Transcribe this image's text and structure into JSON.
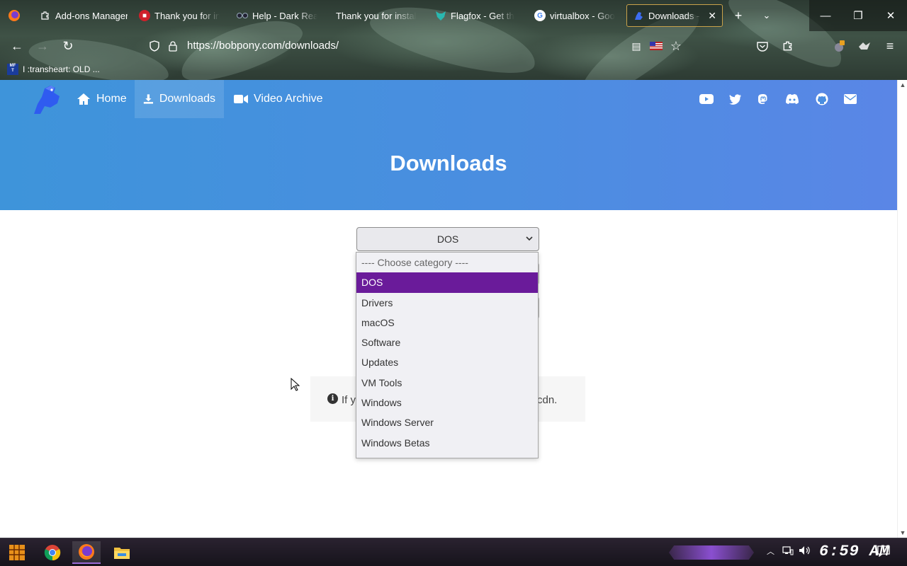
{
  "browser": {
    "tabs": [
      {
        "title": "Add-ons Manager",
        "icon": "puzzle-icon"
      },
      {
        "title": "Thank you for ins",
        "icon": "shield-icon"
      },
      {
        "title": "Help - Dark Read",
        "icon": "glasses-icon"
      },
      {
        "title": "Thank you for install",
        "icon": ""
      },
      {
        "title": "Flagfox - Get th",
        "icon": "flagfox-icon"
      },
      {
        "title": "virtualbox - Goo",
        "icon": "google-icon"
      },
      {
        "title": "Downloads - Bo",
        "icon": "bobpony-icon",
        "active": true
      }
    ],
    "url": "https://bobpony.com/downloads/",
    "bookmark": "I :transheart: OLD ..."
  },
  "site": {
    "nav": {
      "home": "Home",
      "downloads": "Downloads",
      "video_archive": "Video Archive"
    },
    "social_icons": [
      "youtube-icon",
      "twitter-icon",
      "mastodon-icon",
      "discord-icon",
      "github-icon",
      "email-icon"
    ],
    "title": "Downloads",
    "category_select": {
      "selected": "DOS",
      "options": [
        "---- Choose category ----",
        "DOS",
        "Drivers",
        "macOS",
        "Software",
        "Updates",
        "VM Tools",
        "Windows",
        "Windows Server",
        "Windows Betas"
      ]
    },
    "info": {
      "left": "If y",
      "right": "cdn."
    }
  },
  "taskbar": {
    "clock": "6:59 AM"
  },
  "colors": {
    "hero_start": "#3e94da",
    "hero_end": "#5a86e6",
    "selected_option": "#6a1b9a"
  }
}
